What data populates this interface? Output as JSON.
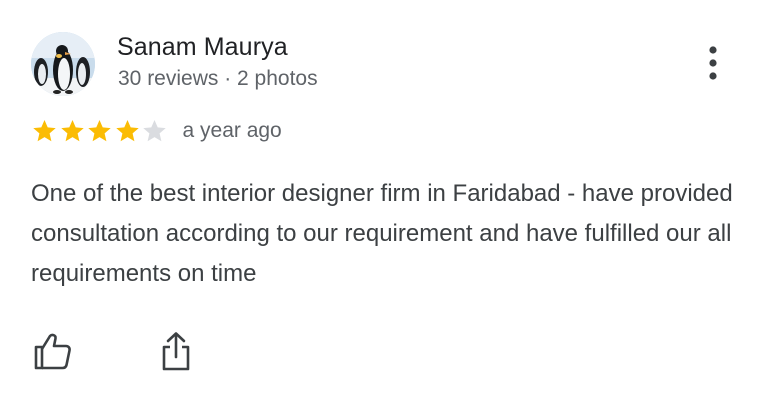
{
  "reviewer": {
    "name": "Sanam Maurya",
    "stats": "30 reviews · 2 photos",
    "avatar_icon": "penguins-avatar"
  },
  "rating": {
    "stars_filled": 4,
    "stars_total": 5,
    "star_color": "#fbbc04",
    "empty_star_color": "#dadce0",
    "time_ago": "a year ago"
  },
  "review": {
    "text": "One of the best interior designer firm in Faridabad - have provided consultation according to our requirement and have fulfilled our all requirements on time"
  },
  "actions": {
    "like_icon": "thumbs-up-icon",
    "share_icon": "share-icon",
    "more_icon": "more-vert-icon"
  }
}
